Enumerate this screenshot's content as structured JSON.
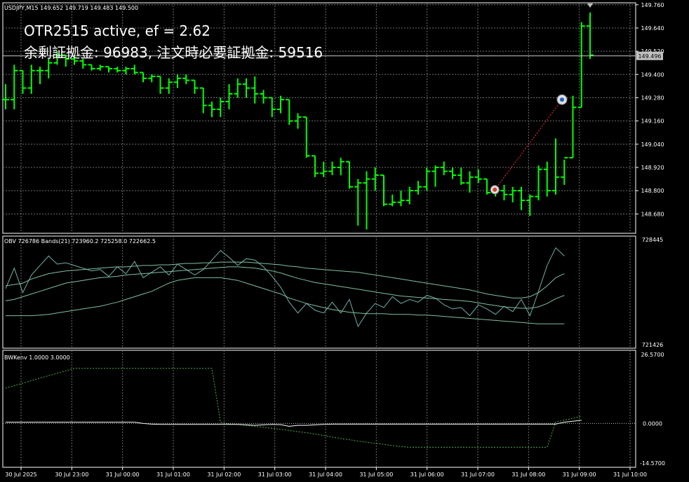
{
  "symbol_header": "USDJPY,M15 149.652 149.719 149.483 149.500",
  "overlay": {
    "line1": "OTR2515 active, ef = 2.62",
    "line2": "余剰証拠金: 96983, 注文時必要証拠金: 59516"
  },
  "colors": {
    "background": "#000000",
    "grid": "#6f6f6f",
    "bull_bar": "#00ff00",
    "obv_line": "#6fb0a8",
    "bands_line": "#7fbf9f",
    "bwk_dashed": "#4caf50",
    "bwk_line": "#ffffff",
    "trade_line": "#ff3333",
    "current_price_tag": "#c0c0c0"
  },
  "price_axis": {
    "labels": [
      "149.760",
      "149.640",
      "149.520",
      "149.400",
      "149.280",
      "149.160",
      "149.040",
      "148.920",
      "148.800",
      "148.680"
    ],
    "current_price": "149.496"
  },
  "obv_header": "OBV 726786 Bands(21) 723960.2 725258.0 722662.5",
  "obv_axis": {
    "top": "728445",
    "bottom": "721426"
  },
  "bwk_header": "BWKenv 1.0000 3.0000",
  "bwk_axis": {
    "top": "26.5700",
    "mid": "0.0000",
    "bottom": "-14.5700"
  },
  "time_axis": [
    "30 Jul 2025",
    "30 Jul 23:00",
    "31 Jul 00:00",
    "31 Jul 01:00",
    "31 Jul 02:00",
    "31 Jul 03:00",
    "31 Jul 04:00",
    "31 Jul 05:00",
    "31 Jul 06:00",
    "31 Jul 07:00",
    "31 Jul 08:00",
    "31 Jul 09:00",
    "31 Jul 10:00"
  ],
  "chart_data": [
    {
      "type": "ohlc",
      "title": "USDJPY,M15",
      "ylim": [
        148.58,
        149.77
      ],
      "ohlc": [
        [
          149.27,
          149.35,
          149.22,
          149.27
        ],
        [
          149.27,
          149.45,
          149.22,
          149.42
        ],
        [
          149.42,
          149.42,
          149.3,
          149.33
        ],
        [
          149.33,
          149.45,
          149.3,
          149.42
        ],
        [
          149.42,
          149.44,
          149.35,
          149.42
        ],
        [
          149.42,
          149.48,
          149.38,
          149.46
        ],
        [
          149.46,
          149.52,
          149.45,
          149.5
        ],
        [
          149.5,
          149.5,
          149.44,
          149.48
        ],
        [
          149.48,
          149.5,
          149.45,
          149.47
        ],
        [
          149.47,
          149.48,
          149.43,
          149.45
        ],
        [
          149.45,
          149.45,
          149.42,
          149.43
        ],
        [
          149.43,
          149.45,
          149.42,
          149.44
        ],
        [
          149.44,
          149.44,
          149.41,
          149.43
        ],
        [
          149.43,
          149.44,
          149.41,
          149.42
        ],
        [
          149.42,
          149.44,
          149.4,
          149.43
        ],
        [
          149.43,
          149.45,
          149.4,
          149.41
        ],
        [
          149.41,
          149.41,
          149.36,
          149.38
        ],
        [
          149.38,
          149.4,
          149.36,
          149.39
        ],
        [
          149.39,
          149.39,
          149.3,
          149.33
        ],
        [
          149.33,
          149.38,
          149.3,
          149.36
        ],
        [
          149.36,
          149.4,
          149.33,
          149.38
        ],
        [
          149.38,
          149.4,
          149.35,
          149.37
        ],
        [
          149.37,
          149.37,
          149.3,
          149.33
        ],
        [
          149.33,
          149.33,
          149.2,
          149.24
        ],
        [
          149.24,
          149.26,
          149.18,
          149.22
        ],
        [
          149.22,
          149.28,
          149.18,
          149.26
        ],
        [
          149.26,
          149.35,
          149.22,
          149.3
        ],
        [
          149.3,
          149.38,
          149.28,
          149.35
        ],
        [
          149.35,
          149.38,
          149.28,
          149.33
        ],
        [
          149.33,
          149.39,
          149.25,
          149.3
        ],
        [
          149.3,
          149.32,
          149.25,
          149.28
        ],
        [
          149.28,
          149.28,
          149.18,
          149.22
        ],
        [
          149.22,
          149.29,
          149.2,
          149.27
        ],
        [
          149.27,
          149.27,
          149.14,
          149.16
        ],
        [
          149.16,
          149.2,
          149.12,
          149.18
        ],
        [
          149.18,
          149.18,
          148.97,
          148.98
        ],
        [
          148.98,
          148.98,
          148.87,
          148.89
        ],
        [
          148.89,
          148.95,
          148.87,
          148.9
        ],
        [
          148.9,
          148.95,
          148.88,
          148.92
        ],
        [
          148.92,
          148.97,
          148.88,
          148.95
        ],
        [
          148.95,
          148.95,
          148.81,
          148.82
        ],
        [
          148.82,
          148.86,
          148.62,
          148.84
        ],
        [
          148.84,
          148.9,
          148.6,
          148.86
        ],
        [
          148.86,
          148.92,
          148.8,
          148.88
        ],
        [
          148.88,
          148.88,
          148.72,
          148.73
        ],
        [
          148.73,
          148.78,
          148.72,
          148.74
        ],
        [
          148.74,
          148.8,
          148.72,
          148.75
        ],
        [
          148.75,
          148.82,
          148.73,
          148.8
        ],
        [
          148.8,
          148.85,
          148.78,
          148.82
        ],
        [
          148.82,
          148.92,
          148.8,
          148.9
        ],
        [
          148.9,
          148.93,
          148.82,
          148.92
        ],
        [
          148.92,
          148.95,
          148.88,
          148.9
        ],
        [
          148.9,
          148.92,
          148.86,
          148.88
        ],
        [
          148.88,
          148.92,
          148.83,
          148.84
        ],
        [
          148.84,
          148.9,
          148.79,
          148.87
        ],
        [
          148.87,
          148.91,
          148.84,
          148.86
        ],
        [
          148.86,
          148.86,
          148.78,
          148.79
        ],
        [
          148.79,
          148.82,
          148.77,
          148.8
        ],
        [
          148.8,
          148.83,
          148.75,
          148.78
        ],
        [
          148.78,
          148.82,
          148.74,
          148.8
        ],
        [
          148.8,
          148.82,
          148.7,
          148.75
        ],
        [
          148.75,
          148.78,
          148.67,
          148.77
        ],
        [
          148.77,
          148.93,
          148.75,
          148.91
        ],
        [
          148.91,
          148.95,
          148.77,
          148.8
        ],
        [
          148.8,
          149.07,
          148.78,
          148.87
        ],
        [
          148.87,
          148.96,
          148.83,
          148.97
        ],
        [
          148.97,
          149.29,
          148.97,
          149.23
        ],
        [
          149.23,
          149.67,
          149.23,
          149.65
        ],
        [
          149.65,
          149.72,
          149.48,
          149.5
        ]
      ]
    },
    {
      "type": "line",
      "title": "OBV Bands(21)",
      "ylim": [
        721426,
        728445
      ],
      "series": [
        {
          "name": "OBV",
          "values": [
            725200,
            726700,
            724900,
            726200,
            726900,
            727600,
            727000,
            727100,
            726900,
            726700,
            726500,
            726600,
            726100,
            726800,
            726300,
            727200,
            726000,
            726400,
            726800,
            726200,
            727000,
            726600,
            726200,
            726600,
            727300,
            728000,
            727500,
            726900,
            727400,
            727300,
            726800,
            726100,
            725300,
            724200,
            723400,
            724100,
            723600,
            723400,
            724200,
            723400,
            724400,
            722400,
            723400,
            724100,
            723800,
            724600,
            724100,
            724400,
            724200,
            724700,
            724500,
            724000,
            723700,
            723800,
            723200,
            724000,
            723700,
            723300,
            723900,
            723500,
            724400,
            723200,
            725000,
            726900,
            728200,
            727600
          ]
        },
        {
          "name": "Upper",
          "values": [
            725400,
            725500,
            725600,
            725900,
            726100,
            726300,
            726400,
            726500,
            726550,
            726600,
            726650,
            726700,
            726750,
            726800,
            726800,
            726850,
            726900,
            726900,
            726950,
            726950,
            727000,
            727050,
            727050,
            727100,
            727100,
            727150,
            727150,
            727150,
            727150,
            727100,
            727050,
            727000,
            726950,
            726850,
            726800,
            726700,
            726650,
            726600,
            726550,
            726500,
            726450,
            726400,
            726300,
            726200,
            726100,
            726000,
            725900,
            725800,
            725700,
            725600,
            725500,
            725400,
            725300,
            725200,
            725100,
            724950,
            724800,
            724700,
            724600,
            724500,
            724500,
            724600,
            724900,
            725400,
            726000,
            726300
          ]
        },
        {
          "name": "Middle",
          "values": [
            724300,
            724400,
            724600,
            724800,
            725000,
            725200,
            725400,
            725600,
            725700,
            725800,
            725900,
            726000,
            726050,
            726100,
            726200,
            726250,
            726300,
            726350,
            726400,
            726450,
            726500,
            726550,
            726600,
            726650,
            726700,
            726750,
            726800,
            726800,
            726750,
            726700,
            726600,
            726500,
            726350,
            726150,
            725950,
            725800,
            725650,
            725550,
            725450,
            725350,
            725250,
            725150,
            725050,
            724950,
            724850,
            724750,
            724650,
            724600,
            724550,
            724500,
            724450,
            724400,
            724350,
            724300,
            724250,
            724150,
            724050,
            723950,
            723850,
            723800,
            723750,
            723750,
            723850,
            724100,
            724450,
            724700
          ]
        },
        {
          "name": "Lower",
          "values": [
            723200,
            723200,
            723200,
            723200,
            723250,
            723300,
            723400,
            723500,
            723600,
            723700,
            723800,
            723900,
            724050,
            724200,
            724400,
            724600,
            724800,
            725000,
            725300,
            725600,
            725800,
            725900,
            726000,
            726000,
            726000,
            726000,
            725900,
            725800,
            725600,
            725400,
            725200,
            725000,
            724800,
            724500,
            724300,
            724100,
            723950,
            723800,
            723650,
            723550,
            723450,
            723400,
            723350,
            723350,
            723350,
            723300,
            723300,
            723300,
            723250,
            723250,
            723200,
            723150,
            723100,
            723050,
            723000,
            722950,
            722900,
            722850,
            722800,
            722750,
            722700,
            722650,
            722600,
            722600,
            722600,
            722600
          ]
        }
      ]
    },
    {
      "type": "line",
      "title": "BWKenv",
      "ylim": [
        -14.57,
        26.57
      ],
      "series": [
        {
          "name": "Envelope",
          "values": [
            14.5,
            15.5,
            16.5,
            17.6,
            18.6,
            19.6,
            20.6,
            21.6,
            22.6,
            22.6,
            22.6,
            22.6,
            22.6,
            22.6,
            22.6,
            22.6,
            22.6,
            22.6,
            22.6,
            22.6,
            22.6,
            22.6,
            22.6,
            22.6,
            22.6,
            0.5,
            -0.2,
            -0.5,
            -0.8,
            -1.2,
            -1.6,
            -2.0,
            -2.4,
            -2.9,
            -3.4,
            -3.8,
            -4.4,
            -5.0,
            -5.6,
            -6.2,
            -6.7,
            -7.3,
            -7.7,
            -8.2,
            -8.6,
            -9.1,
            -9.5,
            -9.8,
            -9.8,
            -9.8,
            -9.8,
            -9.8,
            -9.8,
            -9.8,
            -9.8,
            -9.8,
            -9.8,
            -9.8,
            -9.8,
            -9.8,
            -9.8,
            -9.8,
            -9.8,
            -9.8,
            0.5,
            1.3,
            2.1,
            3.0
          ]
        },
        {
          "name": "Value",
          "values": [
            0.5,
            0.5,
            0.5,
            0.5,
            0.5,
            0.5,
            0.5,
            0.5,
            0.5,
            0.5,
            0.5,
            0.5,
            0.5,
            0.5,
            0.5,
            0.5,
            0.0,
            -0.3,
            -0.4,
            -0.4,
            -0.4,
            -0.4,
            -0.4,
            -0.4,
            -0.4,
            -0.4,
            -0.4,
            -0.4,
            -0.6,
            -0.8,
            -0.6,
            -0.4,
            -0.5,
            -1.2,
            -0.8,
            -0.8,
            -0.6,
            -0.4,
            -0.3,
            -0.3,
            -0.3,
            -0.3,
            -0.3,
            -0.3,
            -0.3,
            -0.3,
            -0.3,
            -0.3,
            -0.3,
            -0.3,
            -0.3,
            -0.3,
            -0.3,
            -0.3,
            -0.3,
            -0.3,
            -0.3,
            -0.3,
            -0.3,
            -0.3,
            -0.3,
            -0.3,
            -0.3,
            -0.3,
            -0.3,
            0.5,
            0.9,
            1.3
          ]
        }
      ]
    }
  ]
}
